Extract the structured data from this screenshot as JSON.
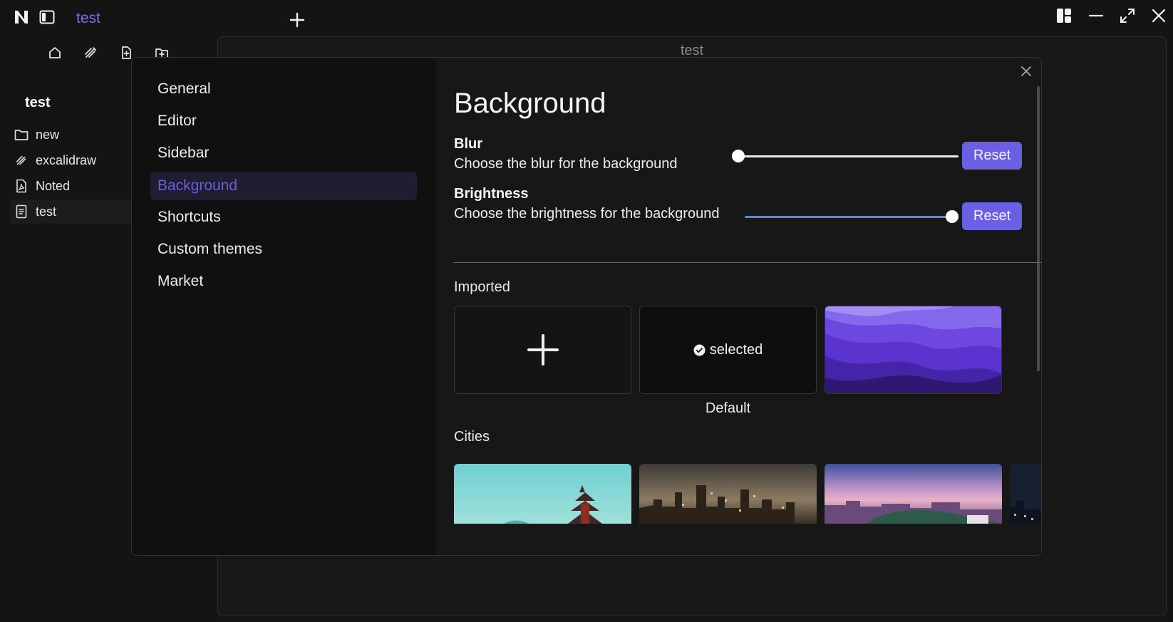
{
  "titlebar": {
    "app_logo": "N",
    "tab_title": "test",
    "new_tab_icon": "plus-icon",
    "layout_icon": "layout-icon",
    "minimize_icon": "minimize-icon",
    "maximize_icon": "maximize-icon",
    "close_icon": "close-icon"
  },
  "editor": {
    "title": "test"
  },
  "sidebar": {
    "toolbar_icons": [
      "home-icon",
      "excalidraw-icon",
      "new-file-icon",
      "new-folder-icon"
    ],
    "workspace_title": "test",
    "items": [
      {
        "label": "new",
        "icon": "folder-icon"
      },
      {
        "label": "excalidraw",
        "icon": "excalidraw-icon"
      },
      {
        "label": "Noted",
        "icon": "pdf-file-icon"
      },
      {
        "label": "test",
        "icon": "note-file-icon"
      }
    ]
  },
  "settings": {
    "nav": [
      "General",
      "Editor",
      "Sidebar",
      "Background",
      "Shortcuts",
      "Custom themes",
      "Market"
    ],
    "active_nav": "Background",
    "heading": "Background",
    "blur": {
      "name": "Blur",
      "description": "Choose the blur for the background",
      "value": 0,
      "reset_label": "Reset"
    },
    "brightness": {
      "name": "Brightness",
      "description": "Choose the brightness for the background",
      "value": 1,
      "reset_label": "Reset"
    },
    "imported_label": "Imported",
    "selected_label": "selected",
    "default_caption": "Default",
    "cities_label": "Cities",
    "accent_color": "#6b5fe4"
  }
}
